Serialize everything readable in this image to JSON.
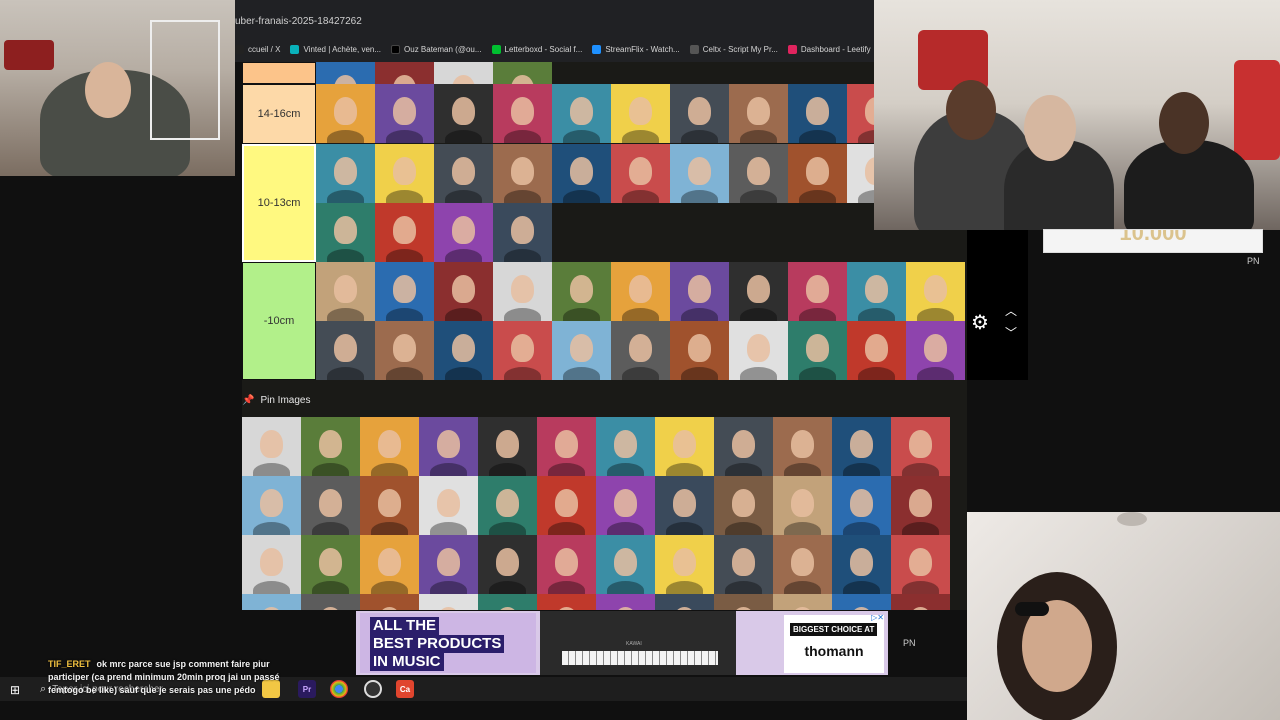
{
  "browser": {
    "tab_title": "uber-franais-2025-18427262",
    "bookmarks": [
      {
        "label": "ccueil / X",
        "color": "#222222"
      },
      {
        "label": "Vinted | Achète, ven...",
        "color": "#09b1ba"
      },
      {
        "label": "Ouz Bateman (@ou...",
        "color": "#000000"
      },
      {
        "label": "Letterboxd - Social f...",
        "color": "#00c030"
      },
      {
        "label": "StreamFlix - Watch...",
        "color": "#1e90ff"
      },
      {
        "label": "Celtx - Script My Pr...",
        "color": "#333333"
      },
      {
        "label": "Dashboard - Leetify",
        "color": "#e0245e"
      }
    ]
  },
  "tiers": [
    {
      "label": "",
      "color": "#fcc48a",
      "count": 4
    },
    {
      "label": "14-16cm",
      "color": "#fdd9a8",
      "count": 10
    },
    {
      "label": "10-13cm",
      "color": "#fff980",
      "count": 14
    },
    {
      "label": "-10cm",
      "color": "#b2f08a",
      "count": 22
    }
  ],
  "pin_images": {
    "label": "Pin Images",
    "count": 48
  },
  "coin_box": {
    "value": "10.000"
  },
  "pn_label": "PN",
  "ad": {
    "headline": [
      "ALL THE",
      "BEST PRODUCTS",
      "IN MUSIC"
    ],
    "tag": "BIGGEST CHOICE AT",
    "brand": "thomann",
    "piano_brand": "KAWAI"
  },
  "taskbar": {
    "search_placeholder": "Taper ici pour rechercher"
  },
  "chat": {
    "username": "TIF_ERET",
    "message": "ok mrc parce sue jsp comment faire piur participer (ca prend minimum 20min proq jai un passé femtogo be like) sauf que je serais pas une pédo"
  },
  "colors": {
    "thumbs": [
      "#3a4a5c",
      "#7a5c44",
      "#c2a27a",
      "#2b6cb0",
      "#8b2f2f",
      "#d7d7d7",
      "#5a7d3a",
      "#e6a23c",
      "#6b4a9e",
      "#2f2f2f",
      "#b83b5e",
      "#3b8ea5",
      "#f0d04a",
      "#444c55",
      "#9c6b4e",
      "#1f4f7a",
      "#c94c4c",
      "#7fb3d5",
      "#5c5c5c",
      "#a0522d",
      "#e0e0e0",
      "#2e7d6b",
      "#c0392b",
      "#8e44ad"
    ]
  }
}
